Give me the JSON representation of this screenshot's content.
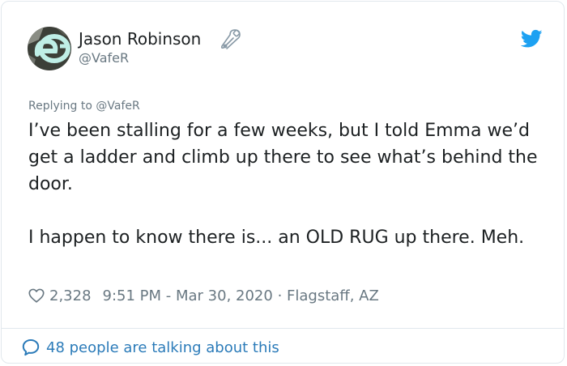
{
  "author": {
    "name": "Jason Robinson",
    "handle": "@VafeR",
    "avatar_icon": "avatar-ae-logo",
    "badge_icon": "safety-pin-icon"
  },
  "brand_icon": "twitter-bird-icon",
  "reply_context": "Replying to @VafeR",
  "tweet": {
    "paragraph1": "I’ve been stalling for a few weeks, but I told Emma we’d get a ladder and climb up there to see what’s behind the door.",
    "paragraph2": "I happen to know there is... an OLD RUG up there. Meh."
  },
  "meta": {
    "likes": "2,328",
    "timestamp": "9:51 PM - Mar 30, 2020",
    "separator": " · ",
    "location": "Flagstaff, AZ"
  },
  "footer": {
    "talking": "48 people are talking about this"
  },
  "colors": {
    "text": "#1c2022",
    "muted": "#697882",
    "link": "#2b7bb9",
    "twitter_blue": "#1da1f2",
    "border": "#e1e8ed"
  }
}
